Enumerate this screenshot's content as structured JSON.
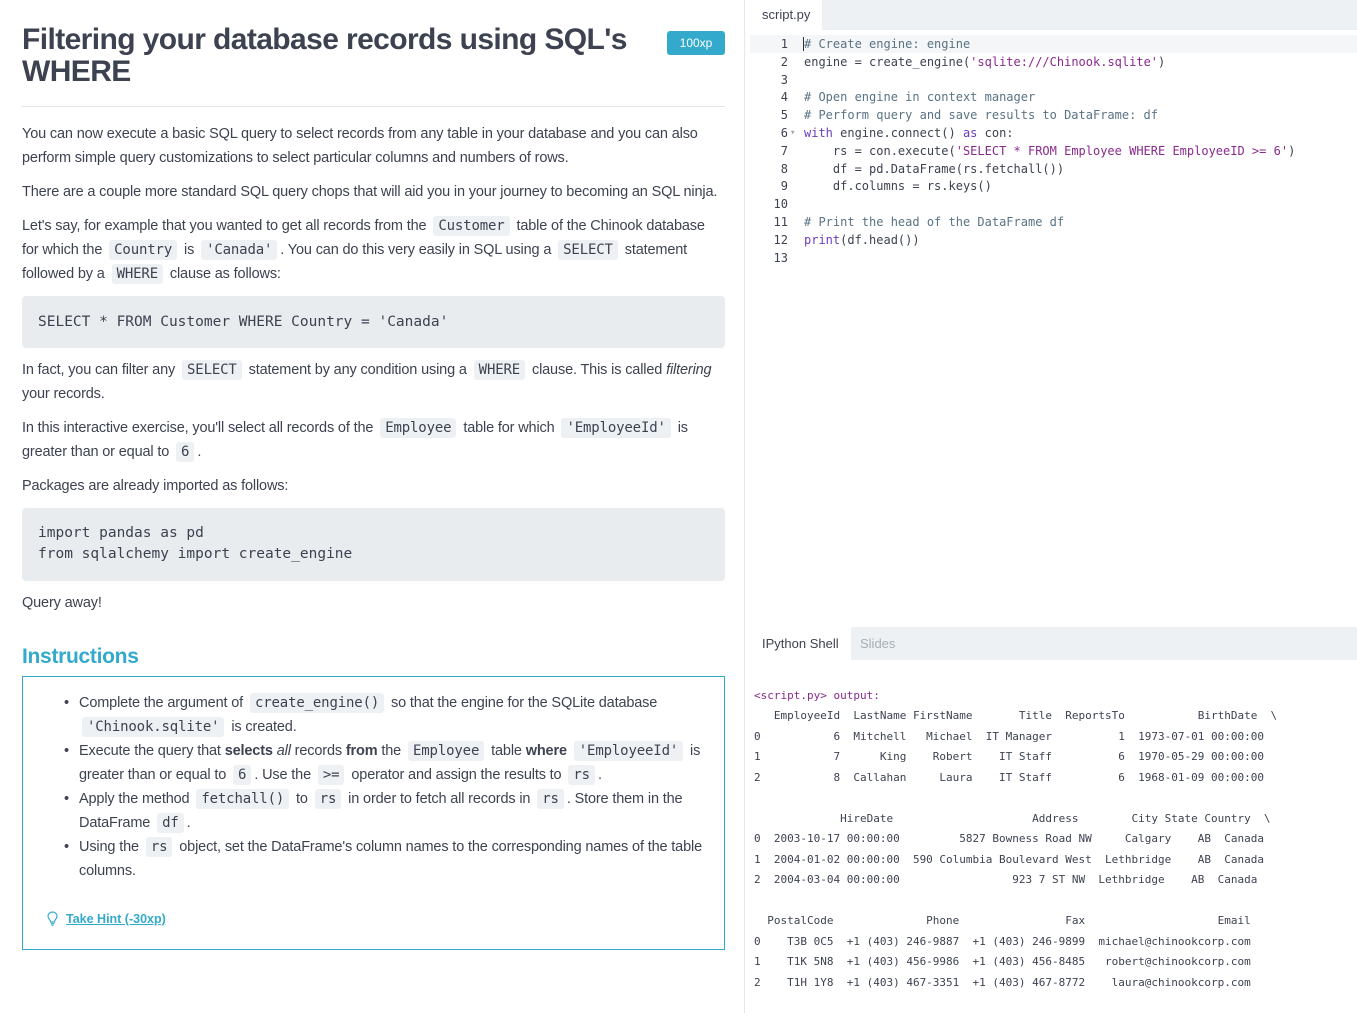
{
  "exercise": {
    "title": "Filtering your database records using SQL's WHERE",
    "xp": "100xp"
  },
  "description": {
    "p1": "You can now execute a basic SQL query to select records from any table in your database and you can also perform simple query customizations to select particular columns and numbers of rows.",
    "p2": "There are a couple more standard SQL query chops that will aid you in your journey to becoming an SQL ninja.",
    "p3": {
      "t1": "Let's say, for example that you wanted to get all records from the",
      "c1": "Customer",
      "t2": "table of the Chinook database for which the",
      "c2": "Country",
      "t3": "is",
      "c3": "'Canada'",
      "t4": ". You can do this very easily in SQL using a",
      "c4": "SELECT",
      "t5": "statement followed by a",
      "c5": "WHERE",
      "t6": "clause as follows:"
    },
    "code1": "SELECT * FROM Customer WHERE Country = 'Canada'",
    "p4": {
      "t1": "In fact, you can filter any",
      "c1": "SELECT",
      "t2": "statement by any condition using a",
      "c2": "WHERE",
      "t3": "clause. This is called",
      "em": "filtering",
      "t4": "your records."
    },
    "p5": {
      "t1": "In this interactive exercise, you'll select all records of the",
      "c1": "Employee",
      "t2": "table for which",
      "c2": "'EmployeeId'",
      "t3": "is greater than or equal to",
      "c3": "6",
      "t4": "."
    },
    "p6": "Packages are already imported as follows:",
    "code2_line1": "import pandas as pd",
    "code2_line2": "from sqlalchemy import create_engine",
    "p7": "Query away!"
  },
  "instructions": {
    "heading": "Instructions",
    "item1": {
      "t1": "Complete the argument of",
      "c1": "create_engine()",
      "t2": "so that the engine for the SQLite database",
      "c2": "'Chinook.sqlite'",
      "t3": "is created."
    },
    "item2": {
      "t1": "Execute the query that",
      "b1": "selects",
      "i1": "all",
      "t2": "records",
      "b2": "from",
      "t3": "the",
      "c1": "Employee",
      "t4": "table",
      "b3": "where",
      "c2": "'EmployeeId'",
      "t5": "is greater than or equal to",
      "c3": "6",
      "t6": ". Use the",
      "c4": ">=",
      "t7": "operator and assign the results to",
      "c5": "rs",
      "t8": "."
    },
    "item3": {
      "t1": "Apply the method",
      "c1": "fetchall()",
      "t2": "to",
      "c2": "rs",
      "t3": "in order to fetch all records in",
      "c3": "rs",
      "t4": ". Store them in the DataFrame",
      "c4": "df",
      "t5": "."
    },
    "item4": {
      "t1": "Using the",
      "c1": "rs",
      "t2": "object, set the DataFrame's column names to the corresponding names of the table columns."
    },
    "hint": "Take Hint (-30xp)"
  },
  "editor": {
    "tab": "script.py",
    "lines": [
      {
        "n": "1",
        "parts": [
          {
            "c": "cm",
            "t": "# Create engine: engine"
          }
        ]
      },
      {
        "n": "2",
        "parts": [
          {
            "c": "",
            "t": "engine = create_engine("
          },
          {
            "c": "st",
            "t": "'sqlite:///Chinook.sqlite'"
          },
          {
            "c": "",
            "t": ")"
          }
        ]
      },
      {
        "n": "3",
        "parts": []
      },
      {
        "n": "4",
        "parts": [
          {
            "c": "cm",
            "t": "# Open engine in context manager"
          }
        ]
      },
      {
        "n": "5",
        "parts": [
          {
            "c": "cm",
            "t": "# Perform query and save results to DataFrame: df"
          }
        ]
      },
      {
        "n": "6",
        "parts": [
          {
            "c": "kw",
            "t": "with"
          },
          {
            "c": "",
            "t": " engine.connect() "
          },
          {
            "c": "kw",
            "t": "as"
          },
          {
            "c": "",
            "t": " con:"
          }
        ]
      },
      {
        "n": "7",
        "parts": [
          {
            "c": "",
            "t": "    rs = con.execute("
          },
          {
            "c": "st",
            "t": "'SELECT * FROM Employee WHERE EmployeeID >= 6'"
          },
          {
            "c": "",
            "t": ")"
          }
        ]
      },
      {
        "n": "8",
        "parts": [
          {
            "c": "",
            "t": "    df = pd.DataFrame(rs.fetchall())"
          }
        ]
      },
      {
        "n": "9",
        "parts": [
          {
            "c": "",
            "t": "    df.columns = rs.keys()"
          }
        ]
      },
      {
        "n": "10",
        "parts": []
      },
      {
        "n": "11",
        "parts": [
          {
            "c": "cm",
            "t": "# Print the head of the DataFrame df"
          }
        ]
      },
      {
        "n": "12",
        "parts": [
          {
            "c": "kw",
            "t": "print"
          },
          {
            "c": "",
            "t": "(df.head())"
          }
        ]
      },
      {
        "n": "13",
        "parts": []
      }
    ]
  },
  "shell": {
    "tab_shell": "IPython Shell",
    "tab_slides": "Slides",
    "prompt": "<script.py> output:",
    "lines": [
      "   EmployeeId  LastName FirstName       Title  ReportsTo           BirthDate  \\",
      "0           6  Mitchell   Michael  IT Manager          1  1973-07-01 00:00:00",
      "1           7      King    Robert    IT Staff          6  1970-05-29 00:00:00",
      "2           8  Callahan     Laura    IT Staff          6  1968-01-09 00:00:00",
      "",
      "             HireDate                     Address        City State Country  \\",
      "0  2003-10-17 00:00:00         5827 Bowness Road NW     Calgary    AB  Canada",
      "1  2004-01-02 00:00:00  590 Columbia Boulevard West  Lethbridge    AB  Canada",
      "2  2004-03-04 00:00:00                 923 7 ST NW  Lethbridge    AB  Canada",
      "",
      "  PostalCode              Phone                Fax                    Email",
      "0    T3B 0C5  +1 (403) 246-9887  +1 (403) 246-9899  michael@chinookcorp.com",
      "1    T1K 5N8  +1 (403) 456-9986  +1 (403) 456-8485   robert@chinookcorp.com",
      "2    T1H 1Y8  +1 (403) 467-3351  +1 (403) 467-8772    laura@chinookcorp.com"
    ]
  }
}
